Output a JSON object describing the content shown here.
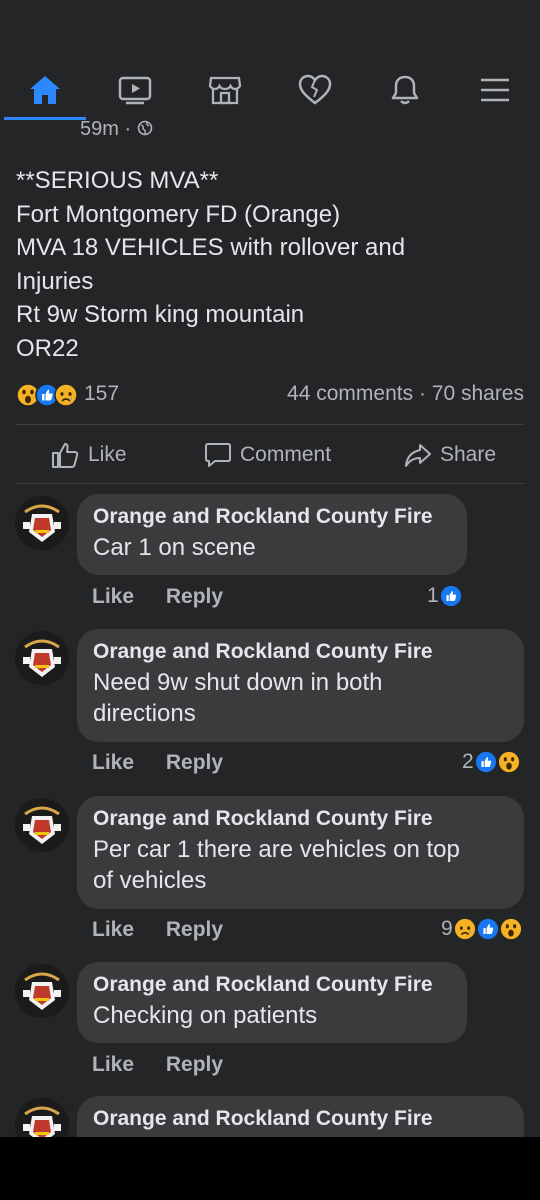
{
  "nav": {
    "items": [
      "home",
      "watch",
      "marketplace",
      "dating",
      "notifications",
      "menu"
    ],
    "active": "home",
    "accent": "#2d88ff"
  },
  "post": {
    "time": "59m",
    "privacy_icon": "globe-icon",
    "lines": [
      "**SERIOUS MVA**",
      "Fort Montgomery FD (Orange)",
      "MVA 18 VEHICLES with rollover and",
      "Injuries",
      "Rt 9w Storm king mountain",
      "OR22"
    ],
    "reaction_count": "157",
    "reaction_types": [
      "wow",
      "like",
      "sad"
    ],
    "comments_label": "44 comments",
    "shares_label": "70 shares"
  },
  "actions": {
    "like": "Like",
    "comment": "Comment",
    "share": "Share"
  },
  "comments": [
    {
      "author": "Orange and Rockland County Fire",
      "text_lines": [
        "Car 1 on scene"
      ],
      "like": "Like",
      "reply": "Reply",
      "reaction_count": "1",
      "reactions": [
        "like"
      ]
    },
    {
      "author": "Orange and Rockland County Fire",
      "text_lines": [
        "Need 9w shut down in both",
        "directions"
      ],
      "like": "Like",
      "reply": "Reply",
      "reaction_count": "2",
      "reactions": [
        "like",
        "wow"
      ]
    },
    {
      "author": "Orange and Rockland County Fire",
      "text_lines": [
        "Per car 1 there are vehicles on top",
        "of vehicles"
      ],
      "like": "Like",
      "reply": "Reply",
      "reaction_count": "9",
      "reactions": [
        "sad",
        "like",
        "wow"
      ]
    },
    {
      "author": "Orange and Rockland County Fire",
      "text_lines": [
        "Checking on patients"
      ],
      "like": "Like",
      "reply": "Reply",
      "reaction_count": "",
      "reactions": []
    },
    {
      "author": "Orange and Rockland County Fire",
      "text_lines": [],
      "like": "",
      "reply": "",
      "reaction_count": "",
      "reactions": []
    }
  ]
}
